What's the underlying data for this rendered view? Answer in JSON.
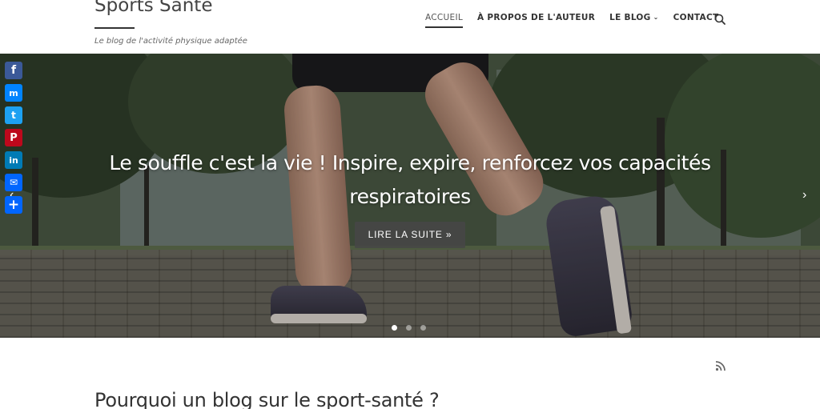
{
  "header": {
    "site_title": "Sports Santé",
    "tagline": "Le blog de l'activité physique adaptée",
    "nav": [
      {
        "label": "ACCUEIL",
        "active": true
      },
      {
        "label": "À PROPOS DE L'AUTEUR",
        "active": false
      },
      {
        "label": "LE BLOG",
        "active": false,
        "has_dropdown": true
      },
      {
        "label": "CONTACT",
        "active": false
      }
    ],
    "search_icon": "search-icon"
  },
  "share": [
    {
      "name": "facebook",
      "glyph": "f",
      "color": "#3b5998"
    },
    {
      "name": "messenger",
      "glyph": "m",
      "color": "#0084ff"
    },
    {
      "name": "twitter",
      "glyph": "t",
      "color": "#1da1f2"
    },
    {
      "name": "pinterest",
      "glyph": "P",
      "color": "#bd081c"
    },
    {
      "name": "linkedin",
      "glyph": "in",
      "color": "#007bb5"
    },
    {
      "name": "email",
      "glyph": "✉",
      "color": "#0166ff"
    },
    {
      "name": "addtoany",
      "glyph": "+",
      "color": "#0166ff"
    }
  ],
  "hero": {
    "headline_line1": "Le souffle c'est la vie ! Inspire, expire, renforcez vos capacités",
    "headline_line2": "respiratoires",
    "read_more": "LIRE LA SUITE »",
    "slides": 3,
    "active_slide": 0
  },
  "main": {
    "rss_icon": "rss-icon",
    "post_title": "Pourquoi un blog sur le sport-santé ?"
  }
}
